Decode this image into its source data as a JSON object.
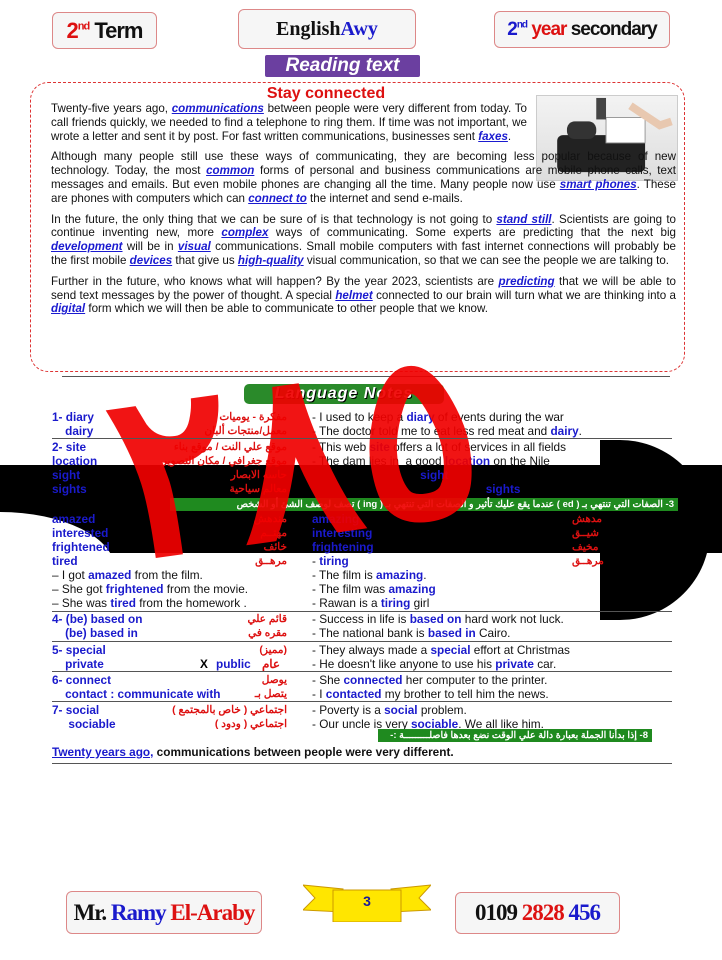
{
  "header": {
    "term_num": "2",
    "term_sup": "nd",
    "term_word": "Term",
    "brand_a": "English",
    "brand_b": "Awy",
    "year_num": "2",
    "year_sup": "nd",
    "year_word": "year",
    "year_rest": "secondary"
  },
  "reading_label": "Reading text",
  "story": {
    "title": "Stay connected",
    "paragraphs": [
      [
        [
          "Twenty-five years ago, ",
          0
        ],
        [
          "communications",
          1
        ],
        [
          " between people were very different from today. To call friends quickly, we needed to find a telephone to ring them. If time was not important, we wrote a letter and sent it by post. For fast written communications, businesses sent ",
          0
        ],
        [
          "faxes",
          1
        ],
        [
          ".",
          0
        ]
      ],
      [
        [
          "Although many people still use these ways of communicating, they are becoming less popular because of new technology. Today, the most ",
          0
        ],
        [
          "common",
          1
        ],
        [
          " forms of personal and business communications are mobile phone calls, text messages and emails. But even mobile phones are changing all the time. Many people now use ",
          0
        ],
        [
          "smart phones",
          1
        ],
        [
          ". These are phones with computers which can ",
          0
        ],
        [
          "connect to",
          1
        ],
        [
          " the internet and send e-mails.",
          0
        ]
      ],
      [
        [
          "In the future, the only thing that we can be sure of is that technology is not going to ",
          0
        ],
        [
          "stand still",
          1
        ],
        [
          ". Scientists are going to continue inventing new, more ",
          0
        ],
        [
          "complex",
          1
        ],
        [
          " ways of communicating. Some experts are predicting that the next big ",
          0
        ],
        [
          "development",
          1
        ],
        [
          " will be in ",
          0
        ],
        [
          "visual",
          1
        ],
        [
          " communications. Small mobile computers with fast internet connections will probably be the first mobile ",
          0
        ],
        [
          "devices",
          1
        ],
        [
          " that give us ",
          0
        ],
        [
          "high-quality",
          1
        ],
        [
          " visual communication, so that we can see the people we are talking to.",
          0
        ]
      ],
      [
        [
          "Further in the future, who knows what will happen? By the year 2023, scientists are ",
          0
        ],
        [
          "predicting",
          1
        ],
        [
          " that we will be able to send text messages by the power of thought. A special ",
          0
        ],
        [
          "helmet",
          1
        ],
        [
          " connected to our brain will turn what we are thinking into a ",
          0
        ],
        [
          "digital",
          1
        ],
        [
          " form which we will then be able to communicate to other people that we know.",
          0
        ]
      ]
    ]
  },
  "notes_label": "Language Notes",
  "notes": [
    {
      "en": "1- diary",
      "ar": "مفكرة - يوميات",
      "ex": [
        [
          "- I used to keep a ",
          0
        ],
        [
          "diary",
          1
        ],
        [
          " of events during the war",
          0
        ]
      ]
    },
    {
      "en": "    dairy",
      "ar": "معمل/منتجات ألبان",
      "ex": [
        [
          "- The doctor told me to eat less red meat and ",
          0
        ],
        [
          "dairy",
          1
        ],
        [
          ".",
          0
        ]
      ]
    },
    {
      "en": "2- site",
      "ar": "موقع علي النت / موقع بناء",
      "ex": [
        [
          "- This web ",
          0
        ],
        [
          "site",
          1
        ],
        [
          " offers a lot of services in all fields",
          0
        ]
      ]
    },
    {
      "en": "location",
      "ar": "موقع جغرافي / مكان التصوير",
      "ex": [
        [
          "- The dam lies in  a good ",
          0
        ],
        [
          "location",
          1
        ],
        [
          " on the Nile",
          0
        ]
      ]
    },
    {
      "en": "sight",
      "ar": "حاسه الابصار",
      "ex": [
        [
          "",
          0
        ],
        [
          "                                 sight",
          1
        ]
      ]
    },
    {
      "en": "sights",
      "ar": "معالم سياحية",
      "ex": [
        [
          "",
          0
        ],
        [
          "                                                     sights",
          1
        ]
      ]
    },
    {
      "en": "amazed",
      "ar": "مندهش",
      "ex": [
        [
          "",
          0
        ],
        [
          "amazing",
          1
        ]
      ],
      "ar2": "مدهش"
    },
    {
      "en": "interested",
      "ar": "مهتــم",
      "ex": [
        [
          "",
          0
        ],
        [
          "interesting",
          1
        ]
      ],
      "ar2": "شيــق"
    },
    {
      "en": "frightened",
      "ar": "خائف",
      "ex": [
        [
          "",
          0
        ],
        [
          "frightening",
          1
        ]
      ],
      "ar2": "مخيف"
    },
    {
      "en": "tired",
      "ar": "مرهــق",
      "ex": [
        [
          "- ",
          0
        ],
        [
          "tiring",
          1
        ]
      ],
      "ar2": "مرهــق"
    },
    {
      "en": "",
      "ar": "",
      "ex": [
        [
          "- The film is ",
          0
        ],
        [
          "amazing",
          1
        ],
        [
          ".",
          0
        ]
      ],
      "left": [
        [
          "– I got ",
          0
        ],
        [
          "amazed",
          1
        ],
        [
          " from the film.",
          0
        ]
      ]
    },
    {
      "en": "",
      "ar": "",
      "ex": [
        [
          "- The film was ",
          0
        ],
        [
          "amazing",
          1
        ]
      ],
      "left": [
        [
          "– She got ",
          0
        ],
        [
          "frightened",
          1
        ],
        [
          " from the movie.",
          0
        ]
      ]
    },
    {
      "en": "",
      "ar": "",
      "ex": [
        [
          "- Rawan is a ",
          0
        ],
        [
          "tiring",
          1
        ],
        [
          " girl",
          0
        ]
      ],
      "left": [
        [
          "– She was ",
          0
        ],
        [
          "tired",
          1
        ],
        [
          " from the homework  .",
          0
        ]
      ]
    },
    {
      "en": "4- (be) based on",
      "ar": "قائم علي",
      "ex": [
        [
          "- Success in life is ",
          0
        ],
        [
          "based on",
          1
        ],
        [
          " hard work not luck.",
          0
        ]
      ]
    },
    {
      "en": "    (be) based in",
      "ar": "مقره في",
      "ex": [
        [
          "- The national bank is ",
          0
        ],
        [
          "based in",
          1
        ],
        [
          " Cairo.",
          0
        ]
      ]
    },
    {
      "en": "5- special",
      "ar": "(مميز)",
      "ex": [
        [
          "- They always made a ",
          0
        ],
        [
          "special",
          1
        ],
        [
          " effort at Christmas",
          0
        ]
      ]
    },
    {
      "en": "    private",
      "ar": "",
      "ex": [
        [
          "- He doesn't like anyone to use his ",
          0
        ],
        [
          "private",
          1
        ],
        [
          " car.",
          0
        ]
      ],
      "x": "X",
      "opp": "public",
      "opp_ar": "عام"
    },
    {
      "en": "6- connect",
      "ar": "يوصل",
      "ex": [
        [
          "- She ",
          0
        ],
        [
          "connected",
          1
        ],
        [
          " her computer to the printer.",
          0
        ]
      ]
    },
    {
      "en": "    contact : communicate with",
      "ar": "يتصل بـ",
      "ex": [
        [
          "- I ",
          0
        ],
        [
          "contacted",
          1
        ],
        [
          " my brother to tell him the news.",
          0
        ]
      ]
    },
    {
      "en": "7- social",
      "ar": "اجتماعي ( خاص بالمجتمع )",
      "ex": [
        [
          "- Poverty is a ",
          0
        ],
        [
          "social",
          1
        ],
        [
          " problem.",
          0
        ]
      ]
    },
    {
      "en": "     sociable",
      "ar": "اجتماعي ( ودود )",
      "ex": [
        [
          "- Our uncle is very ",
          0
        ],
        [
          "sociable",
          1
        ],
        [
          ". We all like him.",
          0
        ]
      ]
    }
  ],
  "rule3": "3-  الصفات التي  تنتهي بـ ( ed ) عندما يقع عليك تأثير  و الصفات التي تنتهي بـ ( ing ) تصف لوصف الشئ أو الشخص",
  "rule8": "8- إذا بدأنا الجملة بعبارة دالة علي الوقت نضع بعدها فاصلـــــــــة :-",
  "example8": {
    "a": "Twenty years ago,",
    "b": " communications between people were very different."
  },
  "watermark": "٢٨٥",
  "footer": {
    "mr": "Mr.",
    "first": "Ramy",
    "last": "El-Araby",
    "page": "3",
    "ph1": "0109",
    "ph2": "2828",
    "ph3": "456"
  }
}
